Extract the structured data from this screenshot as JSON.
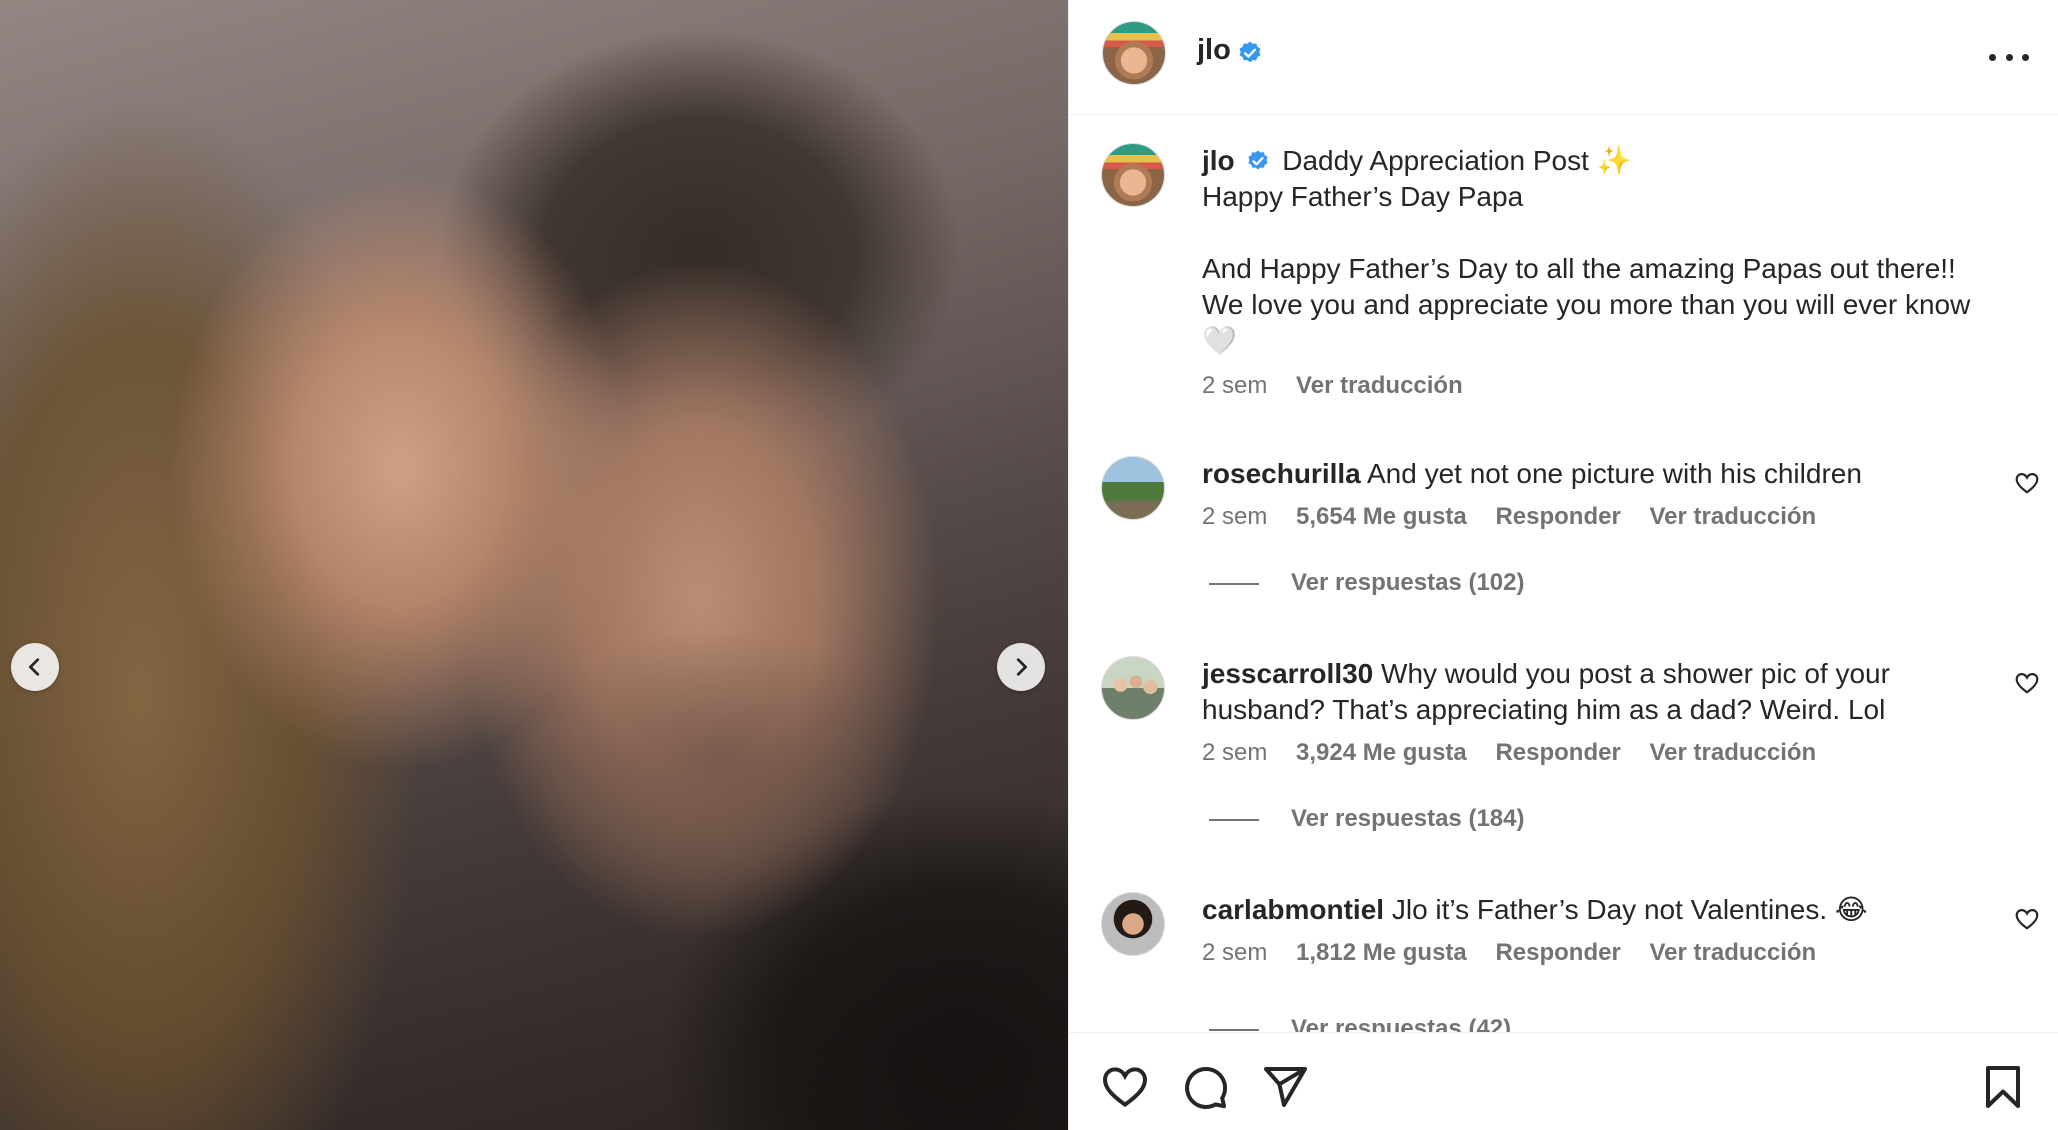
{
  "post": {
    "author": "jlo",
    "caption": {
      "title": "Daddy Appreciation Post",
      "title_emoji": "✨",
      "line1": "Happy Father’s Day Papa",
      "line2": "And Happy Father’s Day to all the amazing Papas out there!!",
      "line3": "We love you and appreciate you more than you will ever know",
      "end_emoji": "🤍",
      "time": "2 sem",
      "translate": "Ver traducción"
    }
  },
  "comments": [
    {
      "user": "rosechurilla",
      "text": "And yet not one picture with his children",
      "time": "2 sem",
      "likes": "5,654 Me gusta",
      "reply": "Responder",
      "translate": "Ver traducción",
      "view_replies": "Ver respuestas (102)"
    },
    {
      "user": "jesscarroll30",
      "text": "Why would you post a shower pic of your husband? That’s appreciating him as a dad? Weird. Lol",
      "time": "2 sem",
      "likes": "3,924 Me gusta",
      "reply": "Responder",
      "translate": "Ver traducción",
      "view_replies": "Ver respuestas (184)"
    },
    {
      "user": "carlabmontiel",
      "text": "Jlo it’s Father’s Day not Valentines.",
      "emoji": "😂",
      "time": "2 sem",
      "likes": "1,812 Me gusta",
      "reply": "Responder",
      "translate": "Ver traducción",
      "view_replies": "Ver respuestas (42)"
    }
  ],
  "icons": {
    "verified_color": "#3897f0",
    "actions": [
      "heart-icon",
      "comment-icon",
      "share-icon",
      "bookmark-icon"
    ]
  }
}
